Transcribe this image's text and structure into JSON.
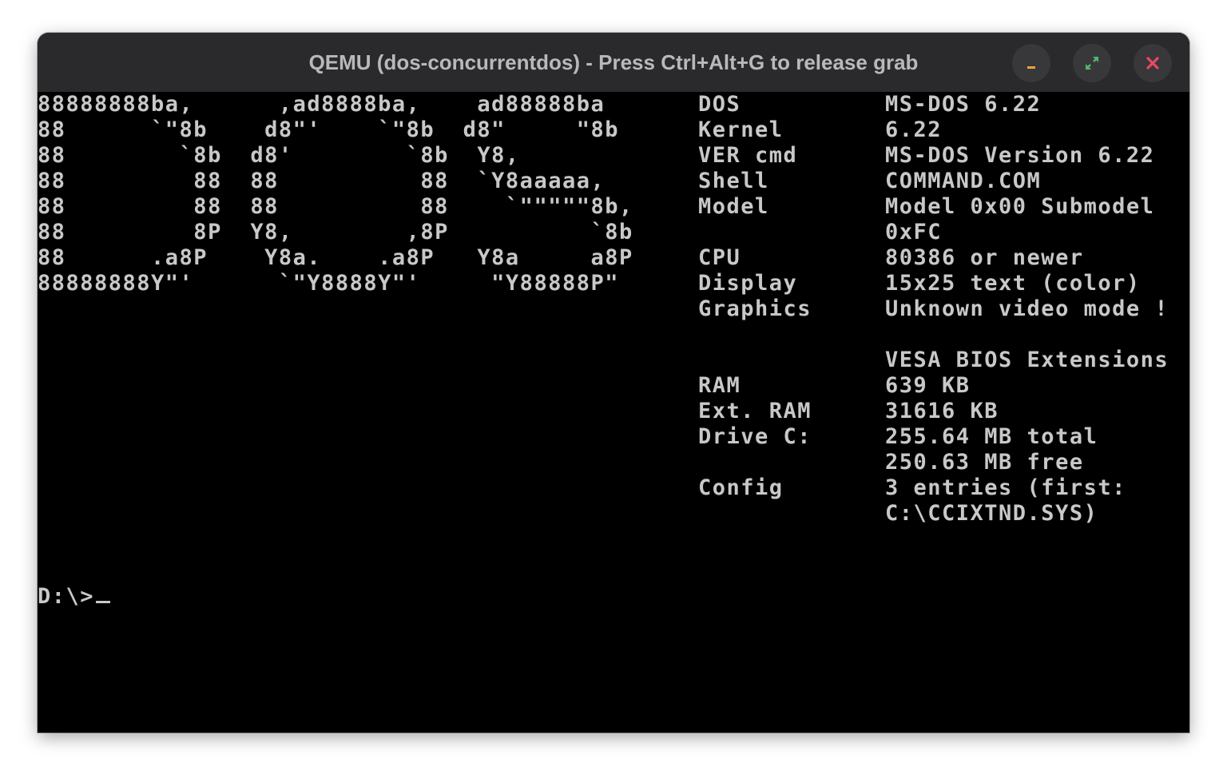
{
  "window": {
    "title": "QEMU (dos-concurrentdos) - Press Ctrl+Alt+G to release grab",
    "buttons": [
      {
        "name": "minimize",
        "icon": "minimize-icon",
        "color": "#e8a33d"
      },
      {
        "name": "maximize",
        "icon": "maximize-icon",
        "color": "#52b66b"
      },
      {
        "name": "close",
        "icon": "close-icon",
        "color": "#e84a5f"
      }
    ]
  },
  "screen": {
    "ascii_art": [
      "88888888ba,      ,ad8888ba,    ad88888ba",
      "88      `\"8b    d8\"'    `\"8b  d8\"     \"8b",
      "88        `8b  d8'        `8b  Y8,",
      "88         88  88          88  `Y8aaaaa,",
      "88         88  88          88    `\"\"\"\"\"8b,",
      "88         8P  Y8,        ,8P          `8b",
      "88      .a8P    Y8a.    .a8P   Y8a     a8P",
      "88888888Y\"'      `\"Y8888Y\"'     \"Y88888P\""
    ],
    "info": [
      {
        "label": "DOS",
        "value": "MS-DOS 6.22"
      },
      {
        "label": "Kernel",
        "value": "6.22"
      },
      {
        "label": "VER cmd",
        "value": "MS-DOS Version 6.22"
      },
      {
        "label": "Shell",
        "value": "COMMAND.COM"
      },
      {
        "label": "Model",
        "value": "Model 0x00 Submodel"
      },
      {
        "label": "",
        "value": "0xFC"
      },
      {
        "label": "CPU",
        "value": "80386 or newer"
      },
      {
        "label": "Display",
        "value": "15x25 text (color)"
      },
      {
        "label": "Graphics",
        "value": "Unknown video mode !"
      },
      {
        "label": "",
        "value": ""
      },
      {
        "label": "",
        "value": "VESA BIOS Extensions"
      },
      {
        "label": "RAM",
        "value": "639 KB"
      },
      {
        "label": "Ext. RAM",
        "value": "31616 KB"
      },
      {
        "label": "Drive C:",
        "value": "255.64 MB total"
      },
      {
        "label": "",
        "value": "250.63 MB free"
      },
      {
        "label": "Config",
        "value": "3 entries (first:"
      },
      {
        "label": "",
        "value": "C:\\CCIXTND.SYS)"
      }
    ],
    "prompt": "D:\\>"
  }
}
